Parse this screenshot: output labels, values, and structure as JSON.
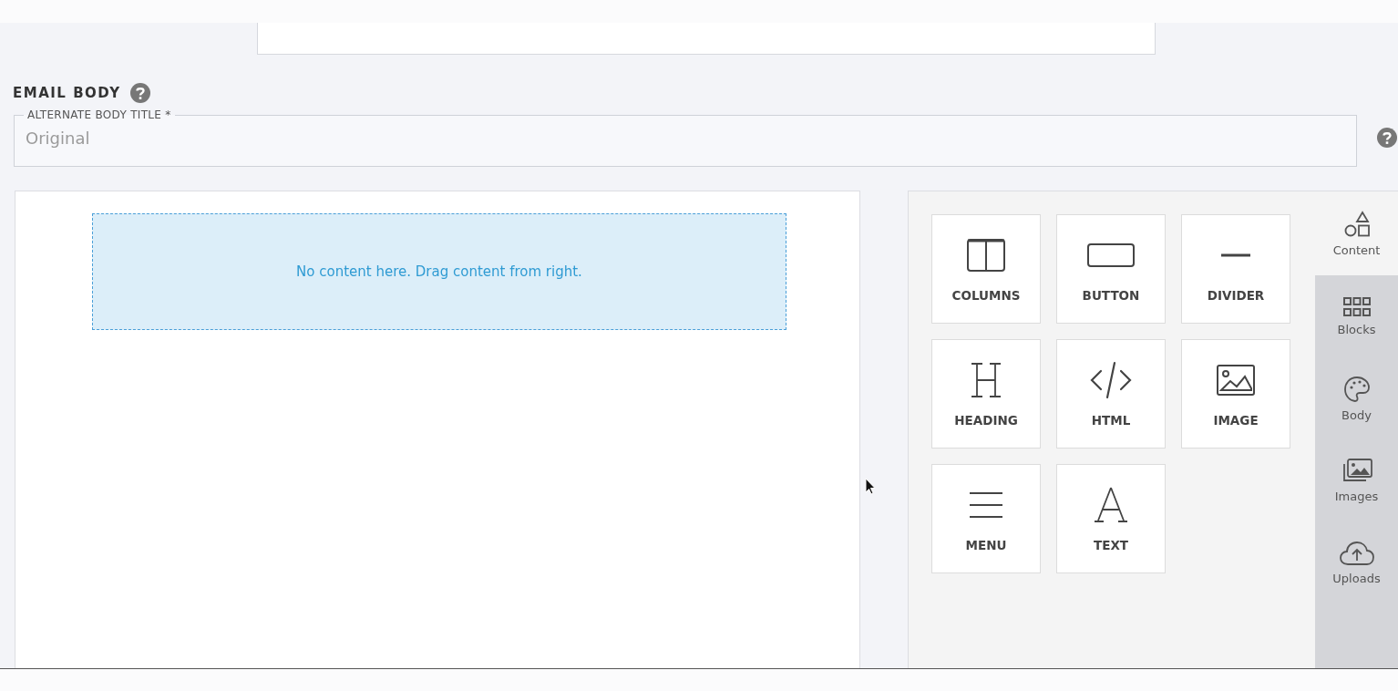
{
  "section": {
    "title": "EMAIL BODY"
  },
  "title_field": {
    "label": "ALTERNATE BODY TITLE *",
    "value": "Original"
  },
  "canvas": {
    "dropzone_text": "No content here. Drag content from right."
  },
  "tools": [
    {
      "kind": "columns",
      "label": "COLUMNS"
    },
    {
      "kind": "button",
      "label": "BUTTON"
    },
    {
      "kind": "divider",
      "label": "DIVIDER"
    },
    {
      "kind": "heading",
      "label": "HEADING"
    },
    {
      "kind": "html",
      "label": "HTML"
    },
    {
      "kind": "image",
      "label": "IMAGE"
    },
    {
      "kind": "menu",
      "label": "MENU"
    },
    {
      "kind": "text",
      "label": "TEXT"
    }
  ],
  "tabs": [
    {
      "kind": "content",
      "label": "Content",
      "selected": true
    },
    {
      "kind": "blocks",
      "label": "Blocks",
      "selected": false
    },
    {
      "kind": "body",
      "label": "Body",
      "selected": false
    },
    {
      "kind": "images",
      "label": "Images",
      "selected": false
    },
    {
      "kind": "uploads",
      "label": "Uploads",
      "selected": false
    }
  ]
}
